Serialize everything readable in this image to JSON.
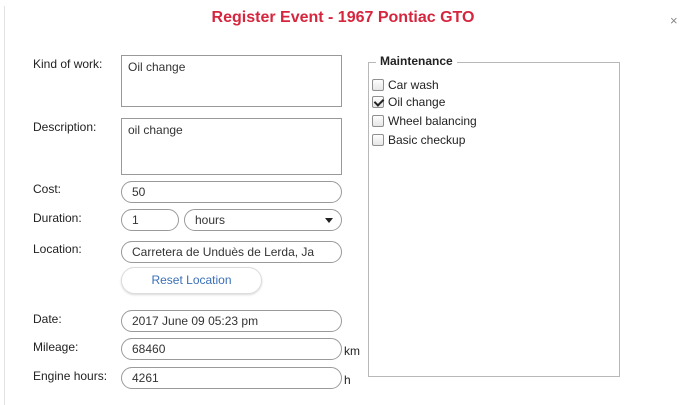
{
  "dialog": {
    "title": "Register Event - 1967 Pontiac GTO",
    "close_glyph": "×"
  },
  "form": {
    "kind_of_work_label": "Kind of work:",
    "kind_of_work_value": "Oil change",
    "description_label": "Description:",
    "description_value": "oil change",
    "cost_label": "Cost:",
    "cost_value": "50",
    "duration_label": "Duration:",
    "duration_value": "1",
    "duration_unit": "hours",
    "location_label": "Location:",
    "location_value": "Carretera de Unduès de Lerda, Ja",
    "reset_location_label": "Reset Location",
    "date_label": "Date:",
    "date_value": "2017 June 09 05:23 pm",
    "mileage_label": "Mileage:",
    "mileage_value": "68460",
    "mileage_unit": "km",
    "engine_hours_label": "Engine hours:",
    "engine_hours_value": "4261",
    "engine_hours_unit": "h"
  },
  "maintenance": {
    "legend": "Maintenance",
    "items": [
      {
        "label": "Car wash",
        "checked": false
      },
      {
        "label": "Oil change",
        "checked": true
      },
      {
        "label": "Wheel balancing",
        "checked": false
      },
      {
        "label": "Basic checkup",
        "checked": false
      }
    ]
  },
  "colors": {
    "title": "#d6263e",
    "link": "#3a6fb7"
  }
}
